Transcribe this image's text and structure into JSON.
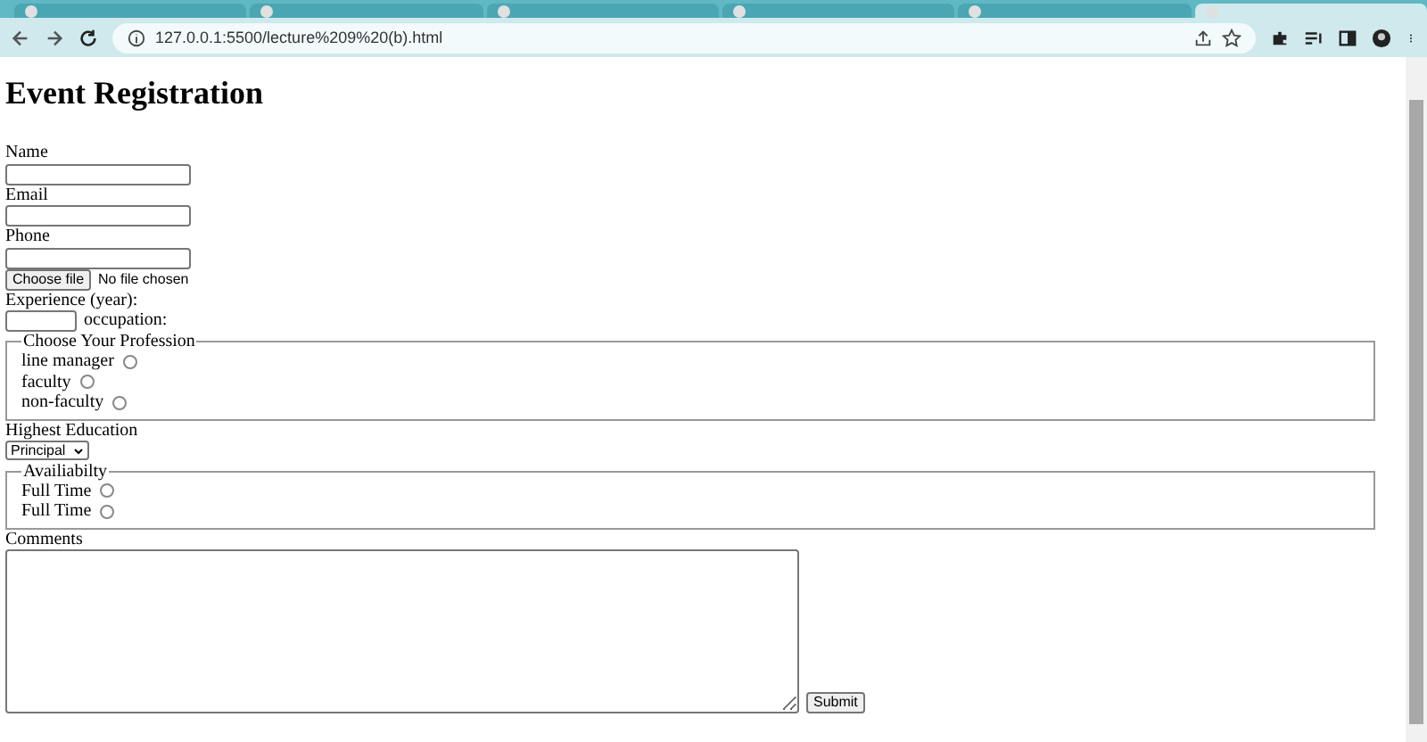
{
  "browser": {
    "tabs": [
      {
        "selected": false
      },
      {
        "selected": false
      },
      {
        "selected": false
      },
      {
        "selected": false
      },
      {
        "selected": false
      },
      {
        "selected": true
      }
    ],
    "url": "127.0.0.1:5500/lecture%209%20(b).html"
  },
  "page": {
    "title": "Event Registration",
    "fields": [
      {
        "kind": "text",
        "label": "Name"
      },
      {
        "kind": "text",
        "label": "Email"
      },
      {
        "kind": "text",
        "label": "Phone"
      },
      {
        "kind": "file",
        "button": "Choose file",
        "status": "No file chosen"
      },
      {
        "kind": "short",
        "label": "Experience (year):",
        "after": "occupation:"
      },
      {
        "kind": "radios",
        "legend": "Choose Your Profession",
        "options": [
          {
            "label": "line manager",
            "selected": false
          },
          {
            "label": "faculty",
            "selected": false
          },
          {
            "label": "non-faculty",
            "selected": false
          }
        ]
      },
      {
        "kind": "select",
        "label": "Highest Education",
        "value": "Principal"
      },
      {
        "kind": "radios",
        "legend": "Availiabilty",
        "options": [
          {
            "label": "Full Time",
            "selected": false
          },
          {
            "label": "Full Time",
            "selected": false
          }
        ]
      },
      {
        "kind": "textarea",
        "label": "Comments",
        "submit": "Submit"
      }
    ]
  }
}
